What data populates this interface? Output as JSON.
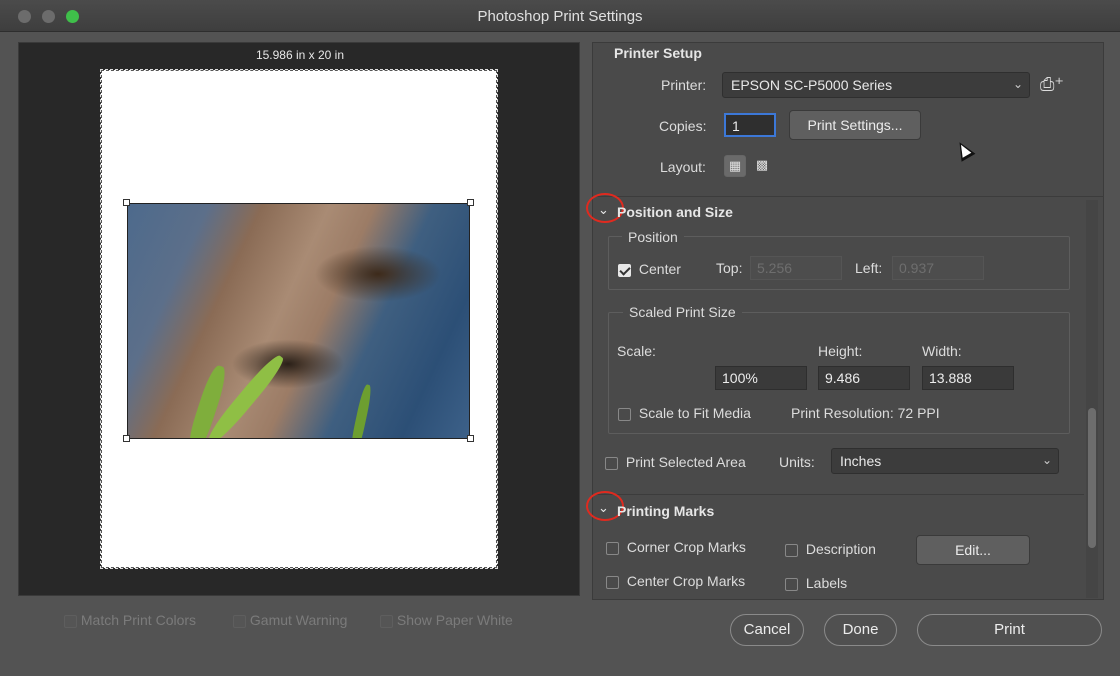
{
  "window": {
    "title": "Photoshop Print Settings"
  },
  "preview": {
    "paper_size": "15.986 in x 20 in",
    "options": [
      {
        "label": "Match Print Colors"
      },
      {
        "label": "Gamut Warning"
      },
      {
        "label": "Show Paper White"
      }
    ]
  },
  "printer_setup": {
    "title": "Printer Setup",
    "printer_label": "Printer:",
    "printer_value": "EPSON SC-P5000 Series",
    "copies_label": "Copies:",
    "copies_value": "1",
    "print_settings_button": "Print Settings...",
    "layout_label": "Layout:"
  },
  "position_size": {
    "title": "Position and Size",
    "position": {
      "title": "Position",
      "center_label": "Center",
      "center_checked": true,
      "top_label": "Top:",
      "top_value": "5.256",
      "left_label": "Left:",
      "left_value": "0.937"
    },
    "scaled": {
      "title": "Scaled Print Size",
      "scale_label": "Scale:",
      "scale_value": "100%",
      "height_label": "Height:",
      "height_value": "9.486",
      "width_label": "Width:",
      "width_value": "13.888",
      "scale_to_fit_label": "Scale to Fit Media",
      "print_resolution": "Print Resolution: 72 PPI"
    },
    "print_selected_label": "Print Selected Area",
    "units_label": "Units:",
    "units_value": "Inches"
  },
  "printing_marks": {
    "title": "Printing Marks",
    "corner_crop_label": "Corner Crop Marks",
    "description_label": "Description",
    "edit_button": "Edit...",
    "center_crop_label": "Center Crop Marks",
    "labels_label": "Labels"
  },
  "footer": {
    "cancel": "Cancel",
    "done": "Done",
    "print": "Print"
  },
  "colors": {
    "annotation": "#e02a1f",
    "maximize": "#3fbf4a"
  }
}
